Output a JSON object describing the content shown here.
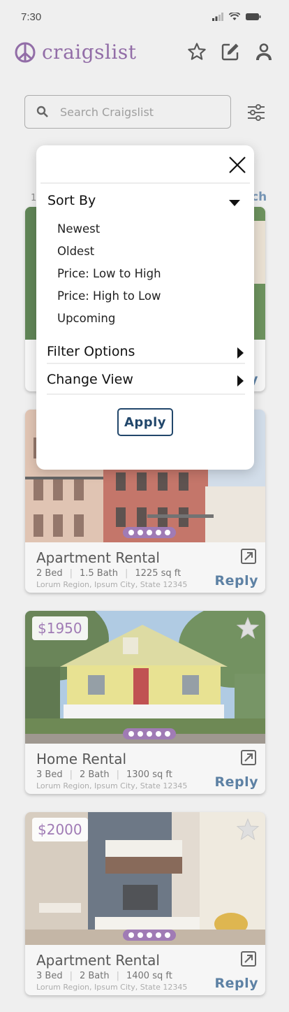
{
  "status_bar": {
    "time": "7:30"
  },
  "header": {
    "brand": "craigslist"
  },
  "search": {
    "placeholder": "Search Craigslist"
  },
  "colors": {
    "brand": "#7a4d94",
    "price": "#8b5fa5",
    "reply": "#3a6690",
    "apply": "#22476b"
  },
  "listings": [
    {
      "price": "",
      "title": "Apartment Rental",
      "beds": "2 Bed",
      "baths": "1.5 Bath",
      "sqft": "1225 sq ft",
      "address": "Lorum Region, Ipsum City, State 12345",
      "reply": "Reply"
    },
    {
      "price": "$1950",
      "title": "Home Rental",
      "beds": "3 Bed",
      "baths": "2 Bath",
      "sqft": "1300 sq ft",
      "address": "Lorum Region, Ipsum City, State 12345",
      "reply": "Reply"
    },
    {
      "price": "$2000",
      "title": "Apartment Rental",
      "beds": "3 Bed",
      "baths": "2 Bath",
      "sqft": "1400 sq ft",
      "address": "Lorum Region, Ipsum City, State 12345",
      "reply": "Reply"
    }
  ],
  "modal": {
    "sort_by": "Sort By",
    "sort_options": [
      "Newest",
      "Oldest",
      "Price: Low to High",
      "Price: High to Low",
      "Upcoming"
    ],
    "filter_options": "Filter Options",
    "change_view": "Change View",
    "apply": "Apply"
  },
  "partial": {
    "left": "1,",
    "right": "ch",
    "reply_fragment": "y"
  }
}
